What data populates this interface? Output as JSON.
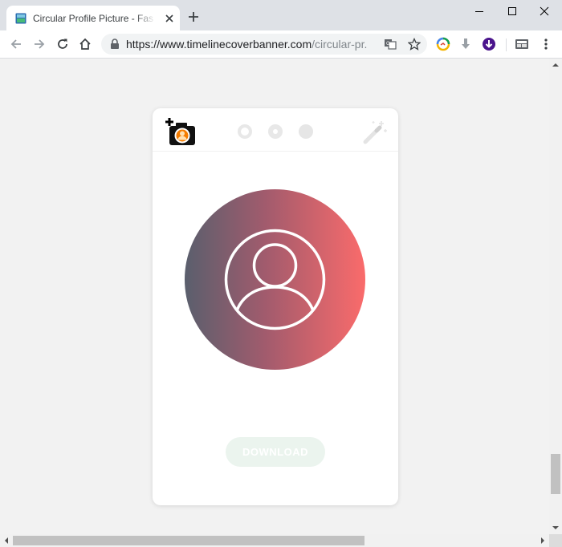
{
  "browser": {
    "tab_title": "Circular Profile Picture - Fast Online Tool",
    "url_main": "https://www.timelinecoverbanner.com",
    "url_rest": "/circular-pr..."
  },
  "toolbar": {
    "icons": [
      "back-icon",
      "forward-icon",
      "reload-icon",
      "home-icon",
      "translate-icon",
      "star-icon",
      "extension-icon",
      "download-icon",
      "extension-download-icon",
      "extension-icon",
      "menu-icon"
    ]
  },
  "editor": {
    "steps": [
      "step-1",
      "step-2",
      "step-3"
    ],
    "download_label": "DOWNLOAD",
    "avatar_gradient": [
      "#5a5f6d",
      "#a25b6d",
      "#fa6b6b"
    ]
  }
}
